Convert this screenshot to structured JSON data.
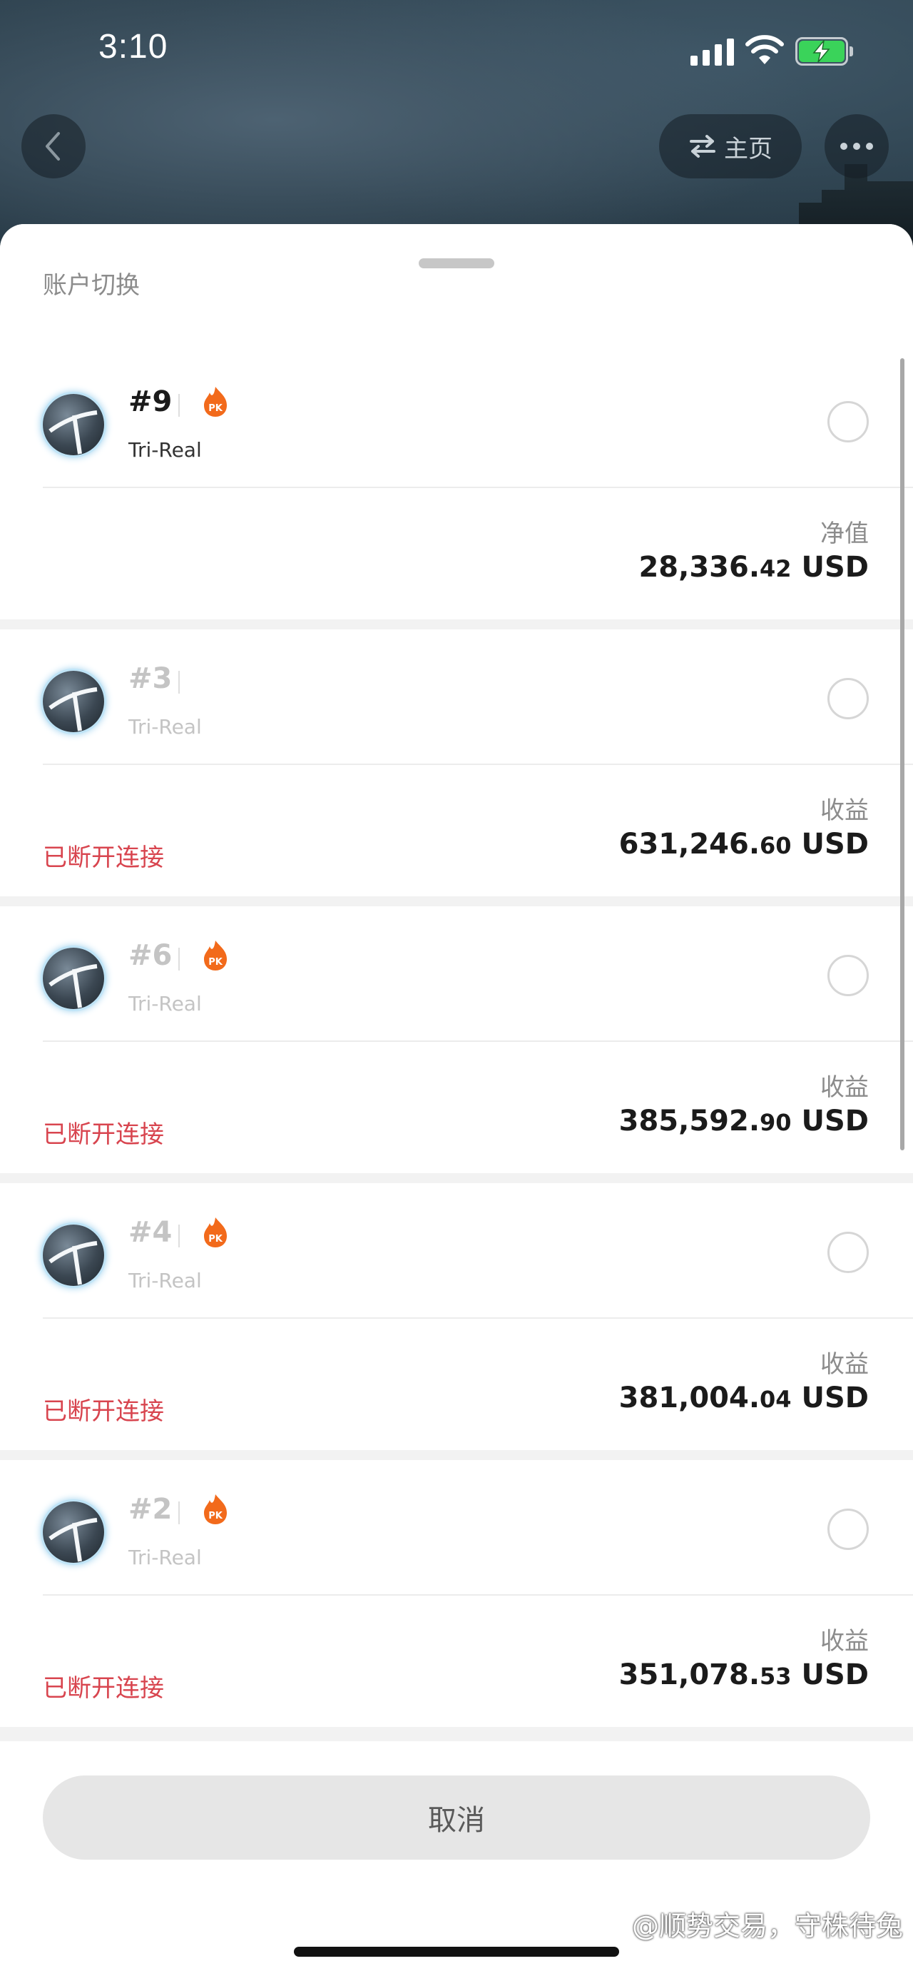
{
  "status_bar": {
    "time": "3:10"
  },
  "nav": {
    "home_label": "主页"
  },
  "sheet": {
    "title": "账户切换"
  },
  "accounts": [
    {
      "number": "#9",
      "type": "Tri-Real",
      "metric_label": "净值",
      "value_int": "28,336.",
      "value_dec": "42",
      "currency": "USD",
      "status": "",
      "has_pk": true
    },
    {
      "number": "#3",
      "type": "Tri-Real",
      "metric_label": "收益",
      "value_int": "631,246.",
      "value_dec": "60",
      "currency": "USD",
      "status": "已断开连接",
      "has_pk": false
    },
    {
      "number": "#6",
      "type": "Tri-Real",
      "metric_label": "收益",
      "value_int": "385,592.",
      "value_dec": "90",
      "currency": "USD",
      "status": "已断开连接",
      "has_pk": true
    },
    {
      "number": "#4",
      "type": "Tri-Real",
      "metric_label": "收益",
      "value_int": "381,004.",
      "value_dec": "04",
      "currency": "USD",
      "status": "已断开连接",
      "has_pk": true
    },
    {
      "number": "#2",
      "type": "Tri-Real",
      "metric_label": "收益",
      "value_int": "351,078.",
      "value_dec": "53",
      "currency": "USD",
      "status": "已断开连接",
      "has_pk": true
    }
  ],
  "footer": {
    "cancel_label": "取消"
  },
  "watermark": "@顺势交易，守株待兔",
  "colors": {
    "status_red": "#d8454f",
    "pk_orange": "#f26a1b",
    "battery_green": "#3ad35a"
  }
}
